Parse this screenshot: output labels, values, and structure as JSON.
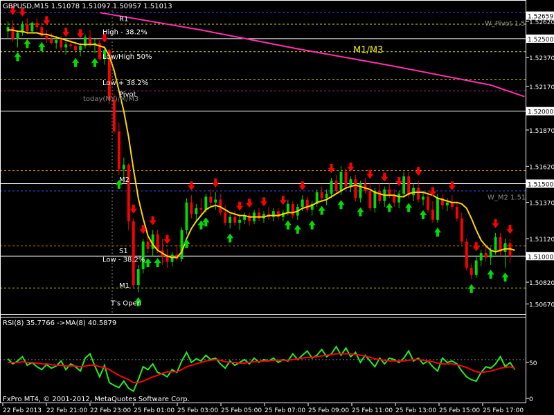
{
  "header": {
    "symbol_info": "GBPUSD,M15  1.51078 1.51097 1.50957 1.51013"
  },
  "footer": {
    "copyright": "FxPro MT4, © 2001-2012, MetaQuotes Software Corp."
  },
  "colors": {
    "bull": "#00dd00",
    "bear": "#ff0000",
    "ma_main": "#ffd700",
    "ma_fast": "#ffa500",
    "pink_ma": "#ff2fb0",
    "level_yellow": "#d6d600",
    "level_orange": "#d68a00",
    "level_white": "#ffffff",
    "level_magenta": "#c0208a",
    "level_blue": "#3a46ff",
    "rsi_line": "#22ee22",
    "rsi_ma": "#ff0000"
  },
  "chart_data": [
    {
      "type": "candlestick",
      "ylim": [
        1.5061,
        1.527
      ],
      "x_ticks": [
        "22 Feb 2013",
        "22 Feb 21:00",
        "22 Feb 23:00",
        "25 Feb 01:00",
        "25 Feb 03:00",
        "25 Feb 05:00",
        "25 Feb 07:00",
        "25 Feb 09:00",
        "25 Feb 11:00",
        "25 Feb 13:00",
        "25 Feb 15:00",
        "25 Feb 17:00"
      ],
      "y_ticks": [
        "1.52620",
        "1.52370",
        "1.52170",
        "1.51870",
        "1.51620",
        "1.51370",
        "1.51120",
        "1.50820",
        "1.50670"
      ],
      "price_tags": [
        {
          "label": "1.52659",
          "value": 1.52659,
          "style": "box"
        },
        {
          "label": "1.52500",
          "value": 1.525,
          "style": "box"
        },
        {
          "label": "1.52000",
          "value": 1.52,
          "style": "box"
        },
        {
          "label": "1.51500",
          "value": 1.515,
          "style": "box"
        },
        {
          "label": "1.51000",
          "value": 1.51,
          "style": "box"
        }
      ],
      "text_annotations": [
        {
          "text": "R1",
          "price": 1.5264
        },
        {
          "text": "High - 38.2%",
          "price": 1.5255
        },
        {
          "text": "M1/M3",
          "price": 1.5242,
          "big": true
        },
        {
          "text": "Low/High 50%",
          "price": 1.5238
        },
        {
          "text": "Low + 38.2%",
          "price": 1.522
        },
        {
          "text": "Pivot",
          "price": 1.5212
        },
        {
          "text": "today(NY)/M/M3",
          "price": 1.5209,
          "muted": true
        },
        {
          "text": "M2",
          "price": 1.5153
        },
        {
          "text": "S1",
          "price": 1.5104
        },
        {
          "text": "Low - 38.2%",
          "price": 1.5098
        },
        {
          "text": "M1",
          "price": 1.508
        },
        {
          "text": "T's Open",
          "price": 1.5068
        },
        {
          "text": "W_Pivot 1.5",
          "price": 1.5261,
          "muted": true
        },
        {
          "text": "W_M2 1.51",
          "price": 1.5141,
          "muted": true
        }
      ],
      "levels": [
        {
          "name": "R1",
          "value": 1.5268,
          "color_key": "level_blue",
          "dash": true
        },
        {
          "name": "W_Pivot",
          "value": 1.526,
          "color_key": "level_yellow",
          "dash": true
        },
        {
          "name": "whole 1.525",
          "value": 1.525,
          "color_key": "level_white",
          "dash": false
        },
        {
          "name": "High-38.2",
          "value": 1.5241,
          "color_key": "level_yellow",
          "dash": true
        },
        {
          "name": "Low+38.2",
          "value": 1.5222,
          "color_key": "level_yellow",
          "dash": true
        },
        {
          "name": "Pivot",
          "value": 1.5214,
          "color_key": "level_magenta",
          "dash": true
        },
        {
          "name": "whole 1.520",
          "value": 1.52,
          "color_key": "level_white",
          "dash": false
        },
        {
          "name": "M2",
          "value": 1.5159,
          "color_key": "level_orange",
          "dash": true
        },
        {
          "name": "whole 1.515",
          "value": 1.515,
          "color_key": "level_white",
          "dash": false
        },
        {
          "name": "W_M2",
          "value": 1.5145,
          "color_key": "level_blue",
          "dash": true
        },
        {
          "name": "S1",
          "value": 1.5107,
          "color_key": "level_orange",
          "dash": true
        },
        {
          "name": "whole 1.510",
          "value": 1.51,
          "color_key": "level_white",
          "dash": false
        },
        {
          "name": "M1",
          "value": 1.5078,
          "color_key": "level_yellow",
          "dash": true
        }
      ],
      "candles": [
        [
          1.5255,
          1.5262,
          1.525,
          1.5258
        ],
        [
          1.5258,
          1.5263,
          1.5248,
          1.525
        ],
        [
          1.525,
          1.5256,
          1.5244,
          1.5254
        ],
        [
          1.5254,
          1.5262,
          1.5252,
          1.526
        ],
        [
          1.526,
          1.5264,
          1.5253,
          1.5255
        ],
        [
          1.5255,
          1.5262,
          1.5254,
          1.5261
        ],
        [
          1.5261,
          1.5264,
          1.5256,
          1.5258
        ],
        [
          1.5258,
          1.5261,
          1.5251,
          1.5252
        ],
        [
          1.5252,
          1.5256,
          1.5247,
          1.525
        ],
        [
          1.525,
          1.5254,
          1.5246,
          1.5247
        ],
        [
          1.5247,
          1.5252,
          1.5243,
          1.5249
        ],
        [
          1.5249,
          1.5252,
          1.5242,
          1.5244
        ],
        [
          1.5244,
          1.5248,
          1.5239,
          1.5246
        ],
        [
          1.5246,
          1.525,
          1.5243,
          1.5245
        ],
        [
          1.5245,
          1.5248,
          1.524,
          1.5242
        ],
        [
          1.5242,
          1.5247,
          1.5238,
          1.5245
        ],
        [
          1.5245,
          1.5253,
          1.5243,
          1.5251
        ],
        [
          1.5251,
          1.5256,
          1.5244,
          1.5246
        ],
        [
          1.5246,
          1.525,
          1.524,
          1.5247
        ],
        [
          1.5247,
          1.5249,
          1.5235,
          1.5236
        ],
        [
          1.5236,
          1.5244,
          1.5232,
          1.5242
        ],
        [
          1.5242,
          1.5243,
          1.5205,
          1.5208
        ],
        [
          1.5208,
          1.5212,
          1.5184,
          1.5186
        ],
        [
          1.5186,
          1.5192,
          1.5156,
          1.516
        ],
        [
          1.516,
          1.5168,
          1.515,
          1.5163
        ],
        [
          1.5163,
          1.5164,
          1.5118,
          1.5124
        ],
        [
          1.5124,
          1.5126,
          1.5078,
          1.508
        ],
        [
          1.508,
          1.5094,
          1.5075,
          1.5091
        ],
        [
          1.5091,
          1.5112,
          1.5088,
          1.511
        ],
        [
          1.511,
          1.5114,
          1.5102,
          1.5105
        ],
        [
          1.5105,
          1.5118,
          1.51,
          1.5115
        ],
        [
          1.5115,
          1.5118,
          1.5102,
          1.5104
        ],
        [
          1.5104,
          1.5112,
          1.5094,
          1.51
        ],
        [
          1.51,
          1.5105,
          1.5092,
          1.5096
        ],
        [
          1.5096,
          1.5103,
          1.5093,
          1.5101
        ],
        [
          1.5101,
          1.5108,
          1.5097,
          1.5098
        ],
        [
          1.5098,
          1.512,
          1.5096,
          1.5118
        ],
        [
          1.5118,
          1.514,
          1.5115,
          1.5137
        ],
        [
          1.5137,
          1.5142,
          1.5126,
          1.5129
        ],
        [
          1.5129,
          1.5136,
          1.5124,
          1.5133
        ],
        [
          1.5133,
          1.514,
          1.5128,
          1.5132
        ],
        [
          1.5132,
          1.5143,
          1.513,
          1.5141
        ],
        [
          1.5141,
          1.5146,
          1.5134,
          1.5137
        ],
        [
          1.5137,
          1.5144,
          1.5132,
          1.5139
        ],
        [
          1.5139,
          1.5143,
          1.5128,
          1.513
        ],
        [
          1.513,
          1.5135,
          1.5121,
          1.5123
        ],
        [
          1.5123,
          1.5129,
          1.5119,
          1.5127
        ],
        [
          1.5127,
          1.5131,
          1.5121,
          1.5123
        ],
        [
          1.5123,
          1.5128,
          1.5118,
          1.5125
        ],
        [
          1.5125,
          1.513,
          1.5122,
          1.5128
        ],
        [
          1.5128,
          1.513,
          1.5121,
          1.5124
        ],
        [
          1.5124,
          1.5132,
          1.5122,
          1.513
        ],
        [
          1.513,
          1.5133,
          1.5124,
          1.5126
        ],
        [
          1.5126,
          1.5131,
          1.5123,
          1.5129
        ],
        [
          1.5129,
          1.5134,
          1.5125,
          1.5127
        ],
        [
          1.5127,
          1.5133,
          1.5124,
          1.5131
        ],
        [
          1.5131,
          1.5133,
          1.5125,
          1.5127
        ],
        [
          1.5127,
          1.5132,
          1.5124,
          1.513
        ],
        [
          1.513,
          1.5139,
          1.5128,
          1.5136
        ],
        [
          1.5136,
          1.5138,
          1.5126,
          1.5128
        ],
        [
          1.5128,
          1.5136,
          1.5125,
          1.5134
        ],
        [
          1.5134,
          1.5142,
          1.5131,
          1.5139
        ],
        [
          1.5139,
          1.5141,
          1.513,
          1.5132
        ],
        [
          1.5132,
          1.5138,
          1.5128,
          1.5136
        ],
        [
          1.5136,
          1.5146,
          1.5134,
          1.5144
        ],
        [
          1.5144,
          1.5148,
          1.5138,
          1.514
        ],
        [
          1.514,
          1.5146,
          1.5135,
          1.5143
        ],
        [
          1.5143,
          1.5154,
          1.514,
          1.5152
        ],
        [
          1.5152,
          1.5156,
          1.5143,
          1.5145
        ],
        [
          1.5145,
          1.5162,
          1.5142,
          1.5158
        ],
        [
          1.5158,
          1.5161,
          1.5146,
          1.5148
        ],
        [
          1.5148,
          1.5155,
          1.5144,
          1.5153
        ],
        [
          1.5153,
          1.5156,
          1.5138,
          1.514
        ],
        [
          1.514,
          1.5152,
          1.5137,
          1.515
        ],
        [
          1.515,
          1.5154,
          1.5143,
          1.5145
        ],
        [
          1.5145,
          1.515,
          1.5131,
          1.5133
        ],
        [
          1.5133,
          1.5147,
          1.513,
          1.5145
        ],
        [
          1.5145,
          1.515,
          1.5136,
          1.5138
        ],
        [
          1.5138,
          1.5148,
          1.5134,
          1.5146
        ],
        [
          1.5146,
          1.515,
          1.514,
          1.5142
        ],
        [
          1.5142,
          1.5146,
          1.5134,
          1.5137
        ],
        [
          1.5137,
          1.5145,
          1.5133,
          1.5143
        ],
        [
          1.5143,
          1.5158,
          1.514,
          1.5155
        ],
        [
          1.5155,
          1.5158,
          1.514,
          1.5142
        ],
        [
          1.5142,
          1.515,
          1.5138,
          1.5147
        ],
        [
          1.5147,
          1.5152,
          1.5137,
          1.5139
        ],
        [
          1.5139,
          1.5145,
          1.5135,
          1.5141
        ],
        [
          1.5141,
          1.5145,
          1.513,
          1.5132
        ],
        [
          1.5132,
          1.5138,
          1.5123,
          1.5125
        ],
        [
          1.5125,
          1.5143,
          1.5123,
          1.514
        ],
        [
          1.514,
          1.5143,
          1.5132,
          1.5135
        ],
        [
          1.5135,
          1.514,
          1.5131,
          1.5137
        ],
        [
          1.5137,
          1.5142,
          1.5132,
          1.5134
        ],
        [
          1.5134,
          1.5137,
          1.5124,
          1.5126
        ],
        [
          1.5126,
          1.513,
          1.5108,
          1.511
        ],
        [
          1.511,
          1.5112,
          1.509,
          1.5092
        ],
        [
          1.5092,
          1.5095,
          1.5084,
          1.5087
        ],
        [
          1.5087,
          1.51,
          1.5085,
          1.5097
        ],
        [
          1.5097,
          1.5104,
          1.5093,
          1.5102
        ],
        [
          1.5102,
          1.5108,
          1.5096,
          1.5099
        ],
        [
          1.5099,
          1.5106,
          1.5094,
          1.5104
        ],
        [
          1.5104,
          1.5116,
          1.5101,
          1.5113
        ],
        [
          1.5113,
          1.5116,
          1.51,
          1.5103
        ],
        [
          1.5103,
          1.5112,
          1.5092,
          1.5109
        ],
        [
          1.5109,
          1.5112,
          1.5095,
          1.51
        ]
      ],
      "up_arrows": [
        2,
        4,
        7,
        14,
        18,
        23,
        27,
        29,
        31,
        37,
        40,
        41,
        46,
        58,
        60,
        63,
        65,
        69,
        73,
        79,
        83,
        86,
        89,
        96,
        100,
        103
      ],
      "down_arrows": [
        1,
        3,
        8,
        12,
        15,
        20,
        26,
        28,
        30,
        33,
        38,
        43,
        48,
        50,
        53,
        57,
        61,
        67,
        71,
        75,
        78,
        81,
        85,
        88,
        92,
        97,
        101,
        104
      ],
      "ma_main": [
        1.5256,
        1.5256,
        1.5255,
        1.5255,
        1.5254,
        1.5254,
        1.5254,
        1.5253,
        1.5253,
        1.5252,
        1.5251,
        1.525,
        1.5249,
        1.5248,
        1.5247,
        1.5246,
        1.5246,
        1.5246,
        1.5246,
        1.5245,
        1.5244,
        1.5238,
        1.5228,
        1.5214,
        1.52,
        1.5182,
        1.516,
        1.514,
        1.5126,
        1.5114,
        1.5108,
        1.5104,
        1.5102,
        1.51,
        1.5099,
        1.5099,
        1.5103,
        1.5112,
        1.5119,
        1.5124,
        1.5128,
        1.5132,
        1.5134,
        1.5135,
        1.5134,
        1.5132,
        1.513,
        1.5129,
        1.5128,
        1.5128,
        1.5127,
        1.5127,
        1.5127,
        1.5127,
        1.5128,
        1.5128,
        1.5128,
        1.5129,
        1.513,
        1.513,
        1.5131,
        1.5133,
        1.5134,
        1.5135,
        1.5137,
        1.5138,
        1.5139,
        1.5141,
        1.5143,
        1.5145,
        1.5147,
        1.5148,
        1.5149,
        1.5148,
        1.5147,
        1.5146,
        1.5144,
        1.5143,
        1.5142,
        1.5142,
        1.5142,
        1.5141,
        1.5141,
        1.5143,
        1.5144,
        1.5144,
        1.5144,
        1.5143,
        1.5142,
        1.514,
        1.5139,
        1.5138,
        1.5137,
        1.5137,
        1.5136,
        1.5133,
        1.5126,
        1.5118,
        1.5111,
        1.5107,
        1.5104,
        1.5103,
        1.5104,
        1.5105,
        1.5105,
        1.5104
      ],
      "ma_pink": [
        [
          19,
          1.5268
        ],
        [
          40,
          1.5256
        ],
        [
          60,
          1.5243
        ],
        [
          80,
          1.5231
        ],
        [
          100,
          1.5218
        ],
        [
          107,
          1.521
        ]
      ]
    },
    {
      "type": "line",
      "title": "RSI(8) 35.7766  ->MA(8) 40.5879",
      "ylim": [
        0,
        100
      ],
      "y_ticks": [
        "50",
        "0"
      ],
      "hline": 50,
      "rsi": [
        55,
        48,
        52,
        58,
        46,
        50,
        44,
        40,
        47,
        42,
        45,
        52,
        40,
        48,
        44,
        38,
        56,
        62,
        45,
        30,
        46,
        22,
        18,
        15,
        24,
        14,
        10,
        26,
        44,
        40,
        48,
        36,
        34,
        30,
        40,
        36,
        52,
        64,
        50,
        55,
        52,
        60,
        54,
        56,
        48,
        42,
        52,
        46,
        50,
        54,
        48,
        56,
        50,
        54,
        52,
        56,
        50,
        54,
        52,
        62,
        54,
        60,
        66,
        56,
        60,
        68,
        58,
        62,
        72,
        60,
        70,
        58,
        64,
        50,
        60,
        52,
        44,
        56,
        48,
        56,
        54,
        50,
        56,
        66,
        52,
        56,
        48,
        52,
        44,
        38,
        56,
        50,
        52,
        48,
        38,
        30,
        26,
        24,
        36,
        44,
        42,
        48,
        58,
        44,
        50,
        40
      ],
      "rsi_ma": [
        50,
        50,
        50,
        51,
        50,
        50,
        49,
        48,
        48,
        47,
        46,
        46,
        45,
        45,
        45,
        44,
        45,
        46,
        46,
        44,
        43,
        40,
        36,
        32,
        29,
        26,
        22,
        22,
        24,
        27,
        30,
        32,
        35,
        37,
        37,
        37,
        40,
        44,
        46,
        48,
        50,
        52,
        53,
        54,
        53,
        51,
        50,
        50,
        49,
        49,
        50,
        51,
        51,
        52,
        52,
        53,
        53,
        53,
        53,
        54,
        55,
        56,
        57,
        57,
        58,
        59,
        60,
        61,
        62,
        62,
        62,
        62,
        61,
        60,
        59,
        57,
        55,
        54,
        53,
        52,
        52,
        52,
        52,
        53,
        54,
        54,
        53,
        52,
        51,
        49,
        48,
        48,
        48,
        47,
        45,
        43,
        40,
        37,
        36,
        37,
        38,
        40,
        42,
        43,
        44,
        42
      ]
    }
  ]
}
